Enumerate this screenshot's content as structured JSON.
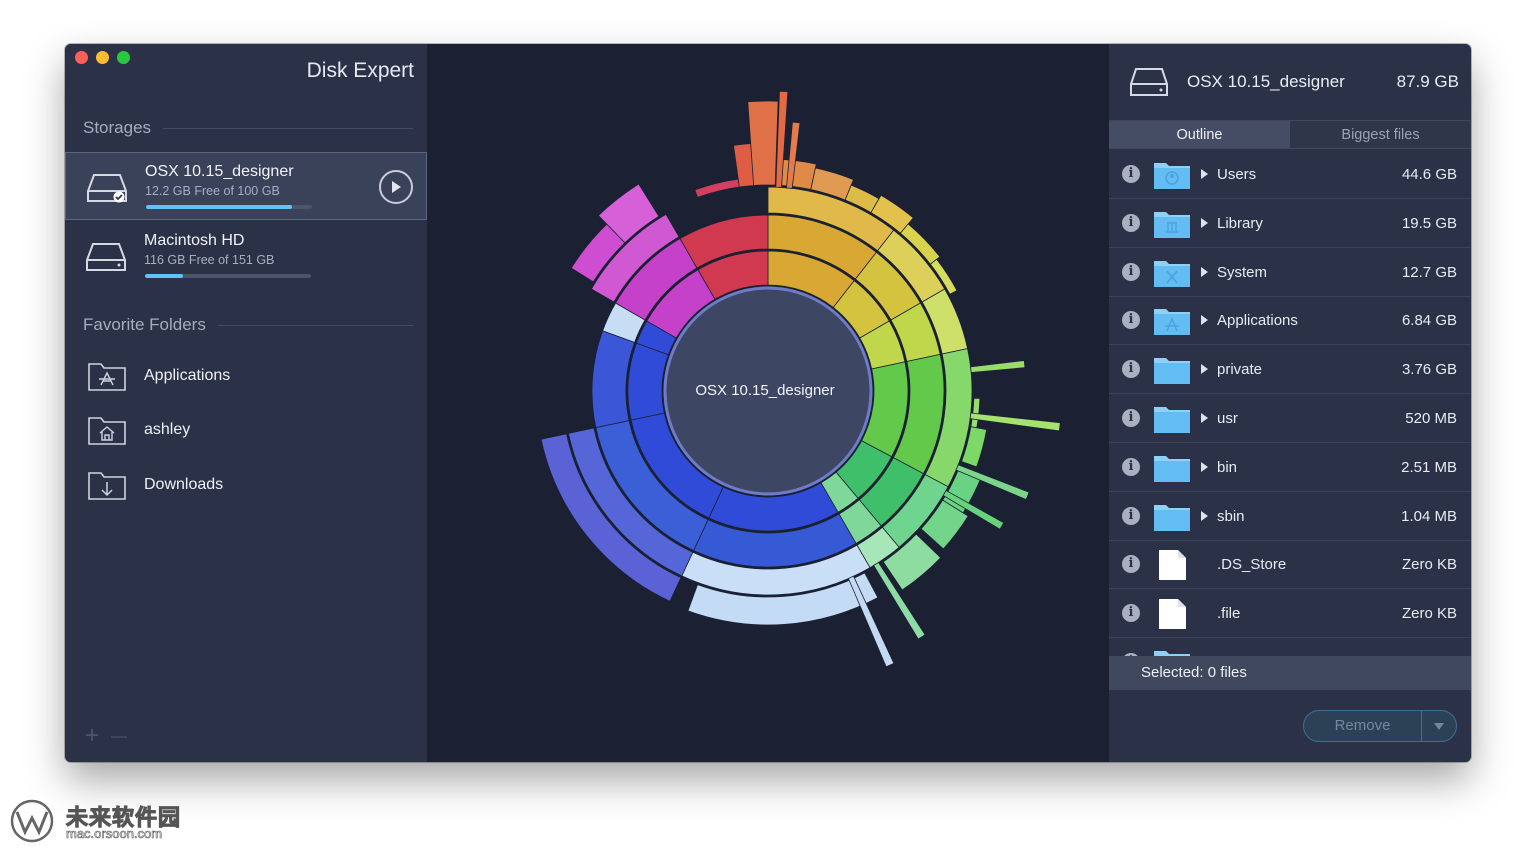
{
  "app": {
    "title": "Disk Expert"
  },
  "sidebar": {
    "storages_heading": "Storages",
    "storages": [
      {
        "name": "OSX 10.15_designer",
        "free_text": "12.2 GB Free of 100 GB",
        "used_fraction": 0.88,
        "selected": true
      },
      {
        "name": "Macintosh HD",
        "free_text": "116 GB Free of 151 GB",
        "used_fraction": 0.23,
        "selected": false
      }
    ],
    "favorites_heading": "Favorite Folders",
    "favorites": [
      {
        "label": "Applications",
        "icon": "applications-folder-icon"
      },
      {
        "label": "ashley",
        "icon": "home-folder-icon"
      },
      {
        "label": "Downloads",
        "icon": "downloads-folder-icon"
      }
    ],
    "add_glyph": "+",
    "remove_glyph": "—"
  },
  "chart": {
    "center_label": "OSX 10.15_designer"
  },
  "details": {
    "disk_name": "OSX 10.15_designer",
    "disk_size": "87.9 GB",
    "tabs": [
      {
        "label": "Outline",
        "active": true
      },
      {
        "label": "Biggest files",
        "active": false
      }
    ],
    "rows": [
      {
        "name": "Users",
        "size": "44.6 GB",
        "kind": "folder",
        "expandable": true,
        "icon": "users-folder-icon"
      },
      {
        "name": "Library",
        "size": "19.5 GB",
        "kind": "folder",
        "expandable": true,
        "icon": "library-folder-icon"
      },
      {
        "name": "System",
        "size": "12.7 GB",
        "kind": "folder",
        "expandable": true,
        "icon": "system-folder-icon"
      },
      {
        "name": "Applications",
        "size": "6.84 GB",
        "kind": "folder",
        "expandable": true,
        "icon": "applications-folder-icon"
      },
      {
        "name": "private",
        "size": "3.76 GB",
        "kind": "folder",
        "expandable": true,
        "icon": "folder-icon"
      },
      {
        "name": "usr",
        "size": "520 MB",
        "kind": "folder",
        "expandable": true,
        "icon": "folder-icon"
      },
      {
        "name": "bin",
        "size": "2.51 MB",
        "kind": "folder",
        "expandable": true,
        "icon": "folder-icon"
      },
      {
        "name": "sbin",
        "size": "1.04 MB",
        "kind": "folder",
        "expandable": true,
        "icon": "folder-icon"
      },
      {
        "name": ".DS_Store",
        "size": "Zero KB",
        "kind": "file",
        "expandable": false,
        "icon": "file-icon"
      },
      {
        "name": ".file",
        "size": "Zero KB",
        "kind": "file",
        "expandable": false,
        "icon": "file-icon"
      }
    ],
    "selected_text": "Selected: 0 files",
    "remove_label": "Remove"
  },
  "watermark": {
    "name": "未来软件园",
    "url": "mac.orsoon.com"
  }
}
